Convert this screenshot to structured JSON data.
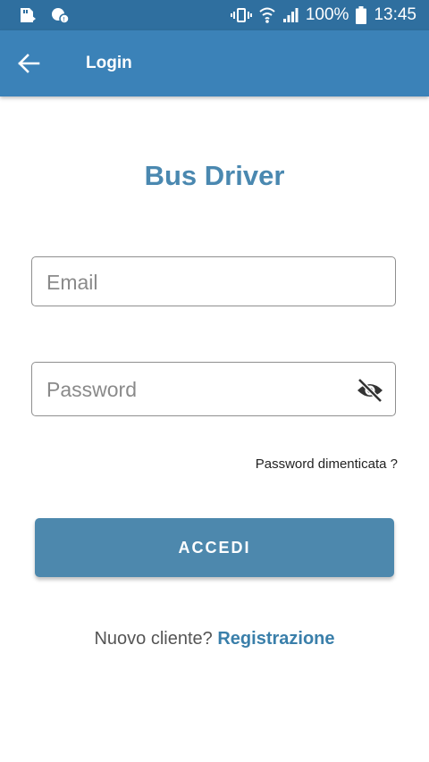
{
  "status_bar": {
    "battery": "100%",
    "time": "13:45"
  },
  "app_bar": {
    "title": "Login"
  },
  "main": {
    "app_title": "Bus Driver",
    "email_placeholder": "Email",
    "password_placeholder": "Password",
    "forgot_password": "Password dimenticata ?",
    "login_button": "ACCEDI",
    "register_prompt": "Nuovo cliente?",
    "register_link": "Registrazione"
  },
  "icons": {
    "back": "arrow-left-icon",
    "password_toggle": "eye-off-icon"
  },
  "colors": {
    "status_bar": "#2f6f9f",
    "app_bar": "#3b82b8",
    "title": "#4a88b0",
    "button": "#4d88ad",
    "link": "#3a7faa"
  }
}
